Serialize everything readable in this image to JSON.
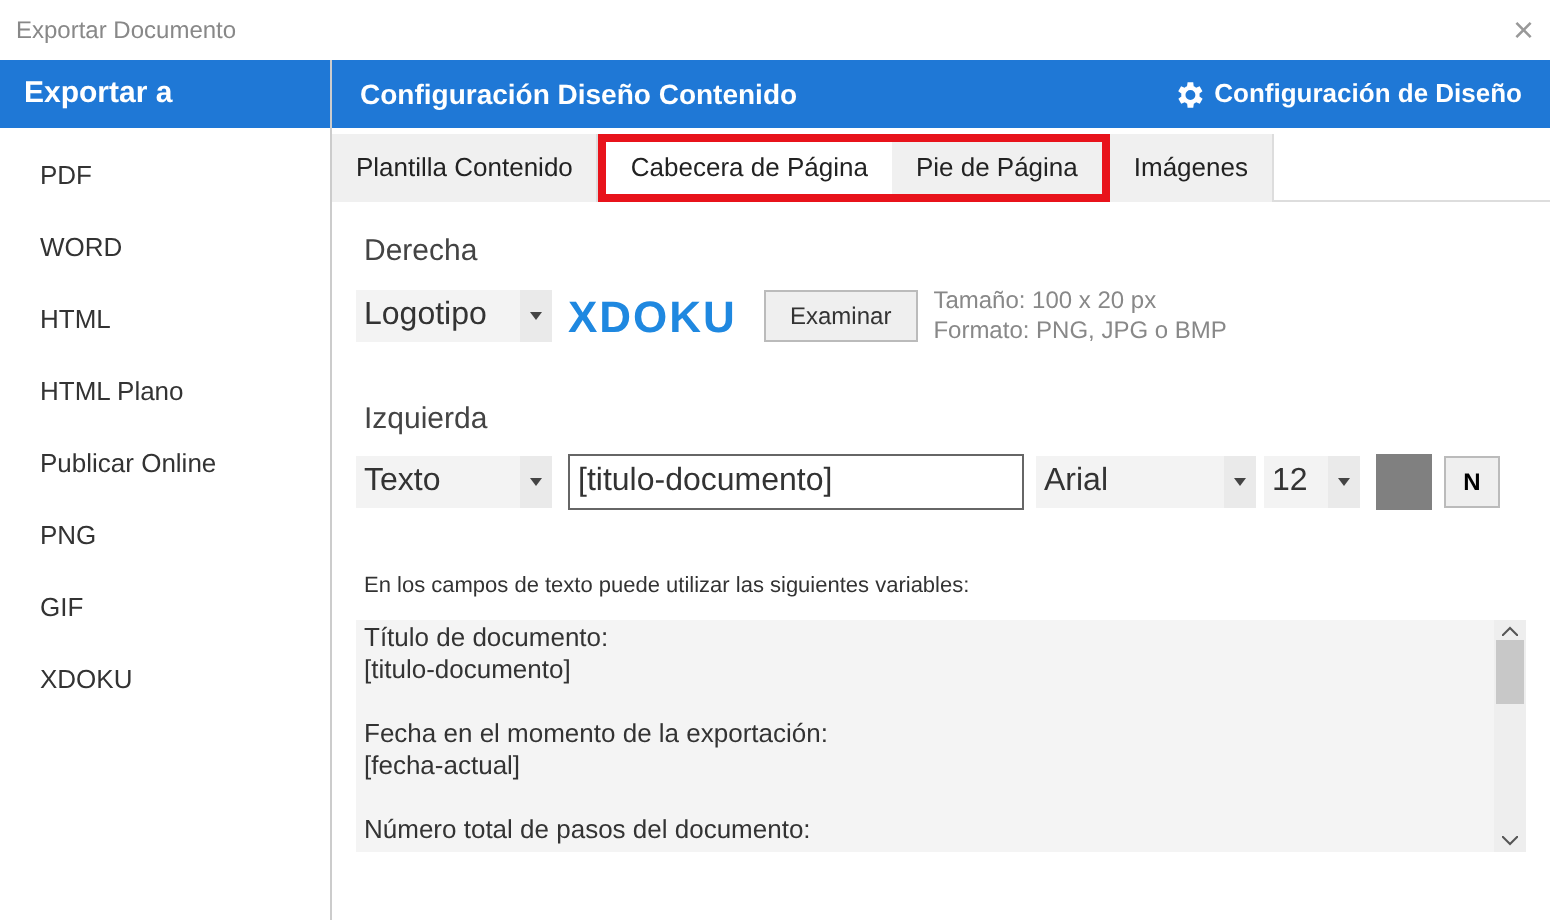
{
  "window": {
    "title": "Exportar Documento",
    "close": "×"
  },
  "sidebar": {
    "title": "Exportar a",
    "items": [
      {
        "label": "PDF",
        "selected": false
      },
      {
        "label": "WORD",
        "selected": false
      },
      {
        "label": "HTML",
        "selected": false
      },
      {
        "label": "HTML Plano",
        "selected": false
      },
      {
        "label": "Publicar Online",
        "selected": false
      },
      {
        "label": "PNG",
        "selected": false
      },
      {
        "label": "GIF",
        "selected": false
      },
      {
        "label": "XDOKU",
        "selected": false
      }
    ]
  },
  "header": {
    "title": "Configuración Diseño Contenido",
    "settings_link": "Configuración de Diseño"
  },
  "tabs": [
    {
      "label": "Plantilla Contenido",
      "selected": false,
      "highlighted": false
    },
    {
      "label": "Cabecera de Página",
      "selected": true,
      "highlighted": true
    },
    {
      "label": "Pie de Página",
      "selected": false,
      "highlighted": true
    },
    {
      "label": "Imágenes",
      "selected": false,
      "highlighted": false
    }
  ],
  "right": {
    "heading": "Derecha",
    "type": "Logotipo",
    "logo": "XDOKU",
    "browse_button": "Examinar",
    "size_hint": "Tamaño: 100 x 20 px",
    "format_hint": "Formato: PNG, JPG o BMP"
  },
  "left": {
    "heading": "Izquierda",
    "type": "Texto",
    "value": "[titulo-documento]",
    "font": "Arial",
    "size": "12",
    "color": "#808080",
    "bold_button": "N"
  },
  "variables": {
    "intro": "En los campos de texto puede utilizar las siguientes variables:",
    "entries": [
      {
        "label": "Título de documento:",
        "variable": "[titulo-documento]"
      },
      {
        "label": "Fecha en el momento de la exportación:",
        "variable": "[fecha-actual]"
      },
      {
        "label": "Número total de pasos del documento:"
      }
    ]
  }
}
